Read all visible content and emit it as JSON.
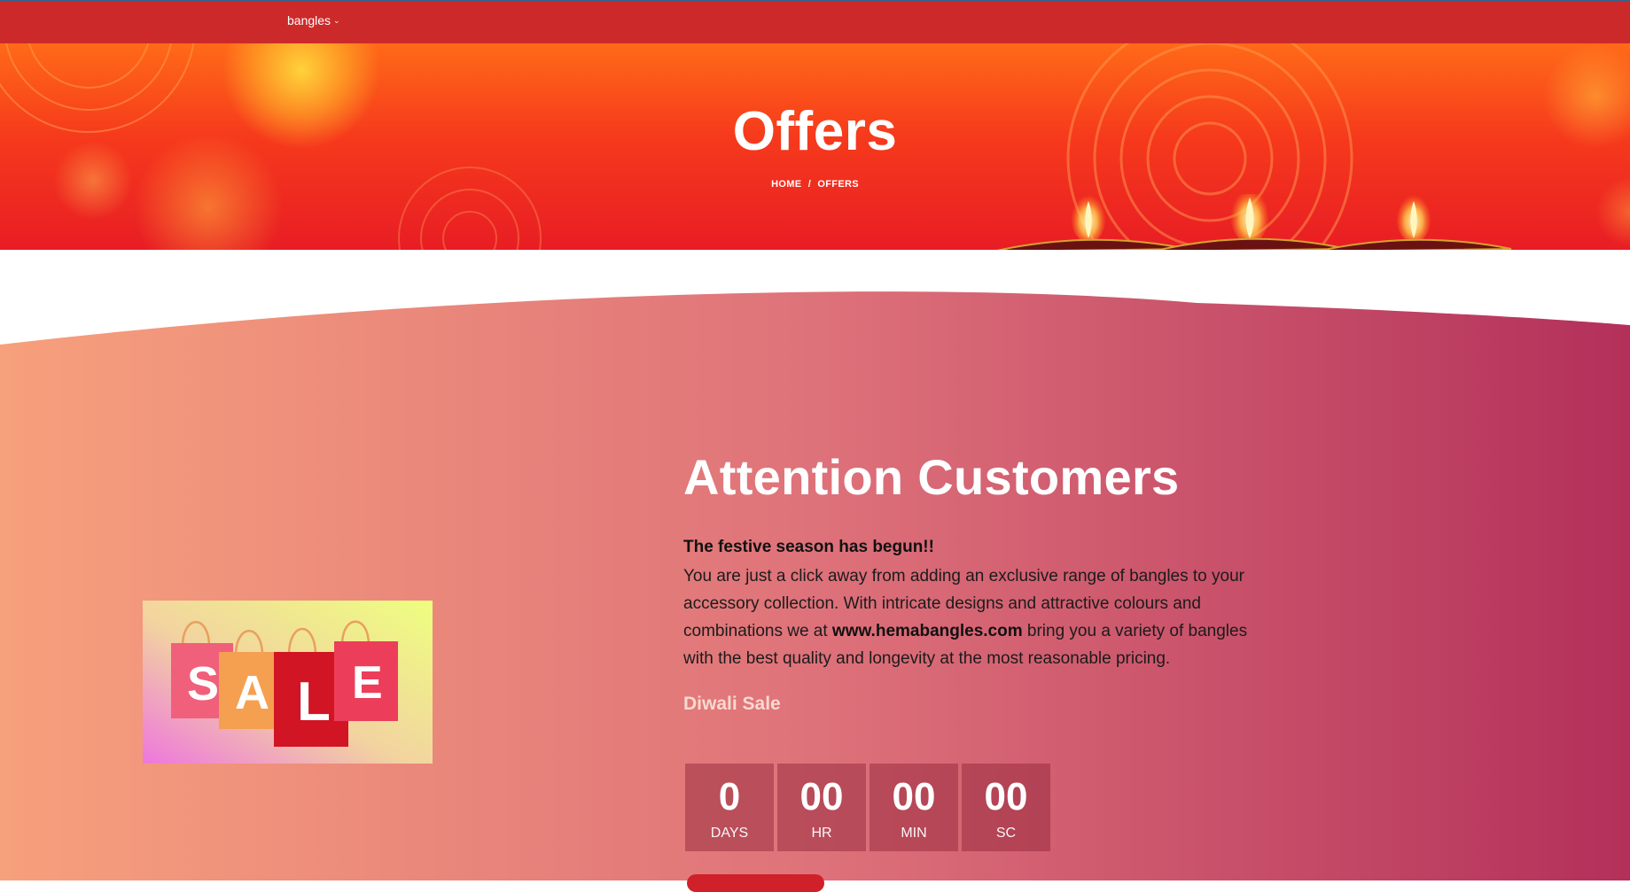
{
  "nav": {
    "menu_label": "bangles",
    "chevron": "chevron-down-icon"
  },
  "hero": {
    "title": "Offers",
    "breadcrumb": {
      "home": "HOME",
      "separator": "/",
      "current": "OFFERS"
    }
  },
  "offer": {
    "heading": "Attention Customers",
    "intro": "The festive season has begun!!",
    "text_before_link": "You are just a click away from adding an exclusive range of bangles to your accessory collection. With intricate designs and attractive colours and combinations we at ",
    "link_text": "www.hemabangles.com",
    "text_after_link": " bring you a variety of bangles with the best quality and longevity at the most reasonable pricing.",
    "sale_name": "Diwali Sale",
    "sale_image_letters": [
      "S",
      "A",
      "L",
      "E"
    ],
    "countdown": [
      {
        "value": "0",
        "label": "DAYS"
      },
      {
        "value": "00",
        "label": "HR"
      },
      {
        "value": "00",
        "label": "MIN"
      },
      {
        "value": "00",
        "label": "SC"
      }
    ]
  },
  "colors": {
    "navbar": "#cc2a2a",
    "hero_top": "#ff6a18",
    "hero_bottom": "#e81d24",
    "gradient_left": "#f7a07c",
    "gradient_right": "#b3305a"
  }
}
